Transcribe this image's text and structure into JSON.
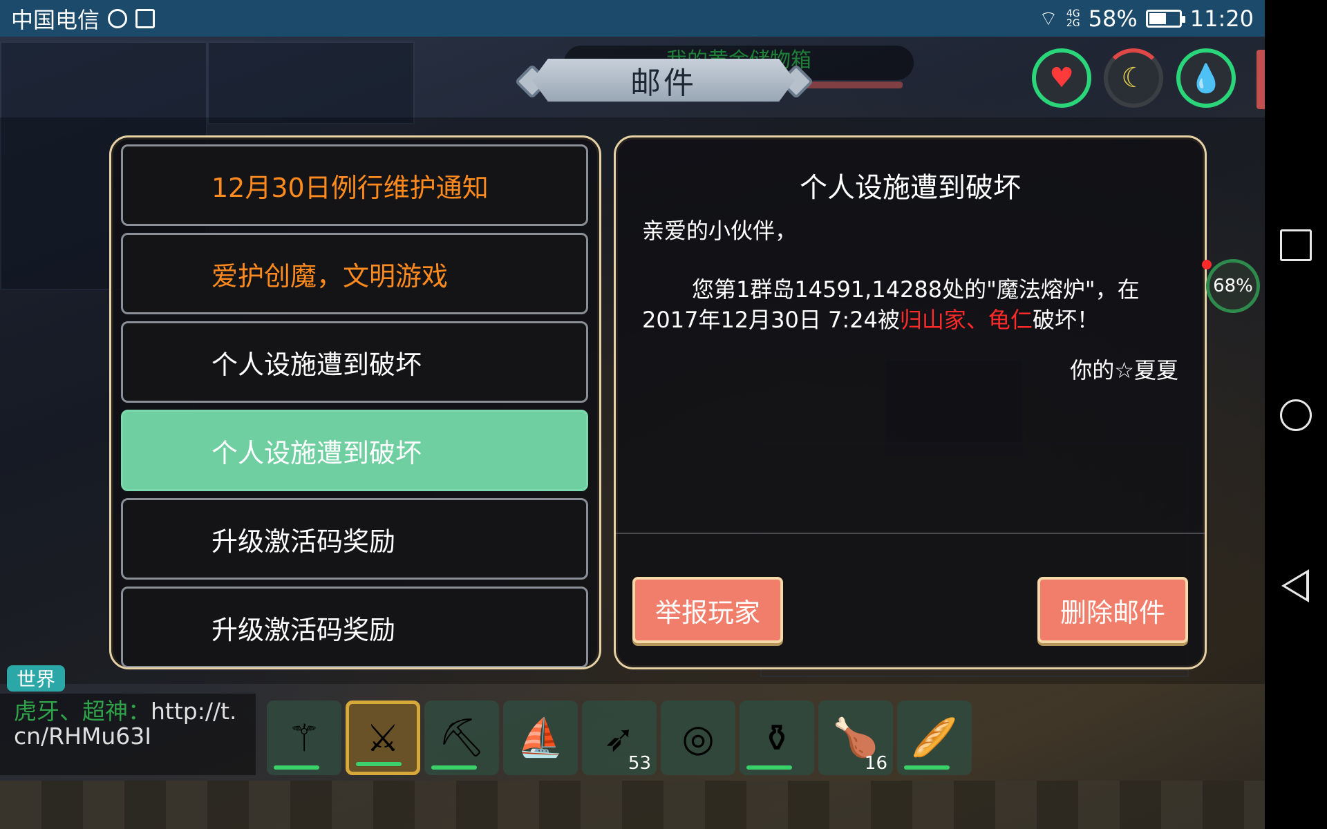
{
  "status_bar": {
    "carrier": "中国电信",
    "network_top": "4G",
    "network_bottom": "2G",
    "battery": "58%",
    "battery_level": 0.58,
    "time": "11:20"
  },
  "hud": {
    "title": "邮件",
    "faded_container_title": "我的黄金储物箱",
    "progress": "68%",
    "stats": {
      "health_icon": "heart-icon",
      "hunger_icon": "banana-icon",
      "thirst_icon": "water-drop-icon"
    }
  },
  "mail_list": [
    {
      "title": "12月30日例行维护通知",
      "color": "#ff8a1e",
      "selected": false
    },
    {
      "title": "爱护创魔，文明游戏",
      "color": "#ff8a1e",
      "selected": false
    },
    {
      "title": "个人设施遭到破坏",
      "color": "#ffffff",
      "selected": false
    },
    {
      "title": "个人设施遭到破坏",
      "color": "#ffffff",
      "selected": true
    },
    {
      "title": "升级激活码奖励",
      "color": "#ffffff",
      "selected": false
    },
    {
      "title": "升级激活码奖励",
      "color": "#ffffff",
      "selected": false
    }
  ],
  "mail_detail": {
    "subject": "个人设施遭到破坏",
    "greeting": "亲爱的小伙伴，",
    "body_before": "您第1群岛14591,14288处的\"魔法熔炉\"，在2017年12月30日 7:24被",
    "body_highlight": "归山家、龟仁",
    "body_after": "破坏！",
    "signature": "你的☆夏夏",
    "report_label": "举报玩家",
    "delete_label": "删除邮件"
  },
  "chat": {
    "channel": "世界",
    "sender": "虎牙、超神：",
    "message": "http://t.cn/RHMu63I"
  },
  "hotbar": [
    {
      "icon": "staff-icon",
      "glyph": "⚚",
      "count": "",
      "durability": true,
      "selected": false
    },
    {
      "icon": "crystal-sword-icon",
      "glyph": "⚔",
      "count": "",
      "durability": true,
      "selected": true
    },
    {
      "icon": "pickaxe-icon",
      "glyph": "⛏",
      "count": "",
      "durability": true,
      "selected": false
    },
    {
      "icon": "boat-icon",
      "glyph": "⛵",
      "count": "",
      "durability": false,
      "selected": false
    },
    {
      "icon": "arrows-icon",
      "glyph": "➶",
      "count": "53",
      "durability": false,
      "selected": false
    },
    {
      "icon": "shield-disc-icon",
      "glyph": "◎",
      "count": "",
      "durability": false,
      "selected": false
    },
    {
      "icon": "flask-icon",
      "glyph": "⚱",
      "count": "",
      "durability": true,
      "selected": false
    },
    {
      "icon": "meat-leg-icon",
      "glyph": "🍗",
      "count": "16",
      "durability": false,
      "selected": false
    },
    {
      "icon": "club-icon",
      "glyph": "🥖",
      "count": "",
      "durability": true,
      "selected": false
    }
  ]
}
